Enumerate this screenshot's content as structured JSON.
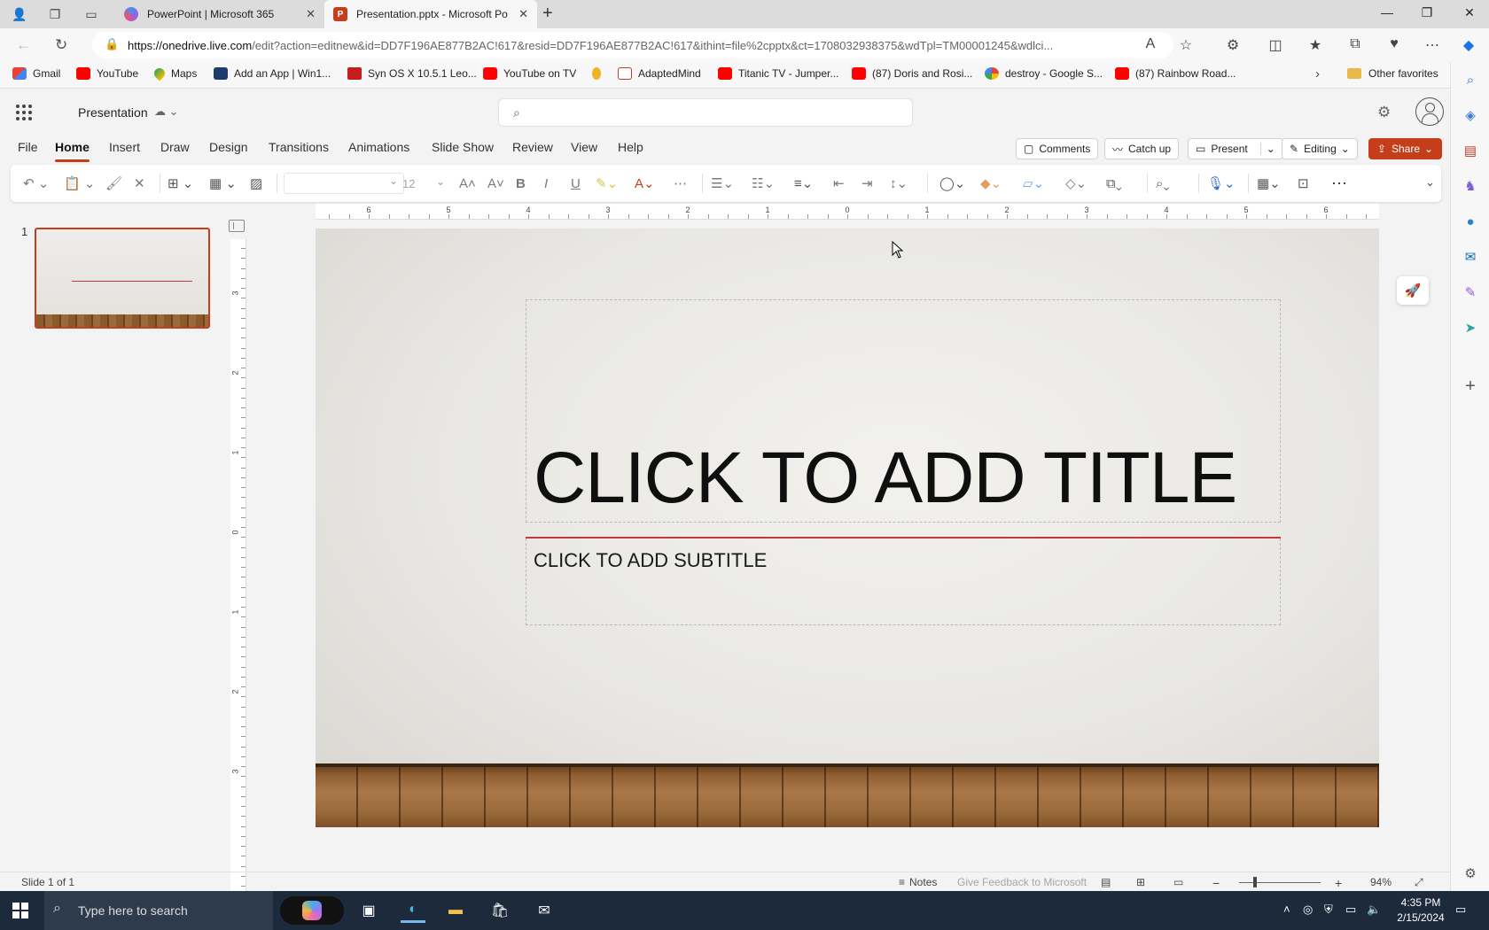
{
  "browser": {
    "tabs": [
      {
        "title": "PowerPoint | Microsoft 365",
        "active": false
      },
      {
        "title": "Presentation.pptx - Microsoft Po",
        "active": true
      }
    ],
    "url_host": "https://onedrive.live.com",
    "url_rest": "/edit?action=editnew&id=DD7F196AE877B2AC!617&resid=DD7F196AE877B2AC!617&ithint=file%2cpptx&ct=1708032938375&wdTpl=TM00001245&wdlci...",
    "favorites": [
      {
        "label": "Gmail",
        "icon": "gmail-icon"
      },
      {
        "label": "YouTube",
        "icon": "youtube-icon"
      },
      {
        "label": "Maps",
        "icon": "maps-icon"
      },
      {
        "label": "Add an App | Win1...",
        "icon": "app-icon"
      },
      {
        "label": "Syn OS X 10.5.1 Leo...",
        "icon": "syn-icon"
      },
      {
        "label": "YouTube on TV",
        "icon": "youtube-icon"
      },
      {
        "label": "",
        "icon": "amazon-icon"
      },
      {
        "label": "AdaptedMind",
        "icon": "adaptedmind-icon"
      },
      {
        "label": "Titanic TV - Jumper...",
        "icon": "youtube-icon"
      },
      {
        "label": "(87) Doris and Rosi...",
        "icon": "youtube-icon"
      },
      {
        "label": "destroy - Google S...",
        "icon": "google-icon"
      },
      {
        "label": "(87) Rainbow Road...",
        "icon": "youtube-icon"
      }
    ],
    "other_favorites": "Other favorites"
  },
  "app": {
    "doc_title": "Presentation",
    "menu": [
      "File",
      "Home",
      "Insert",
      "Draw",
      "Design",
      "Transitions",
      "Animations",
      "Slide Show",
      "Review",
      "View",
      "Help"
    ],
    "active_menu": "Home",
    "buttons": {
      "comments": "Comments",
      "catch_up": "Catch up",
      "present": "Present",
      "editing": "Editing",
      "share": "Share"
    },
    "ribbon": {
      "font_size": "12"
    },
    "accent": "#c43e1c"
  },
  "slides": {
    "count_label": "1",
    "current": {
      "title": "CLICK TO ADD TITLE",
      "subtitle": "CLICK TO ADD SUBTITLE"
    }
  },
  "ruler": {
    "h_labels": [
      "6",
      "5",
      "4",
      "3",
      "2",
      "1",
      "0",
      "1",
      "2",
      "3",
      "4",
      "5",
      "6"
    ],
    "v_labels": [
      "3",
      "2",
      "1",
      "0",
      "1",
      "2",
      "3"
    ]
  },
  "status": {
    "slide_info": "Slide 1 of 1",
    "notes": "Notes",
    "feedback": "Give Feedback to Microsoft",
    "zoom": "94%"
  },
  "taskbar": {
    "search_placeholder": "Type here to search",
    "time": "4:35 PM",
    "date": "2/15/2024"
  }
}
